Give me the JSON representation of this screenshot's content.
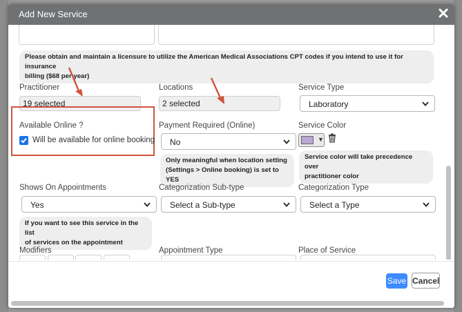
{
  "dialog": {
    "title": "Add New Service"
  },
  "cpt_note": {
    "line1": "Please obtain and maintain a licensure to utilize the American Medical Associations CPT codes if you intend to use it for insurance",
    "line2": "billing ($68 per year)"
  },
  "practitioner": {
    "label": "Practitioner",
    "value": "19 selected"
  },
  "locations": {
    "label": "Locations",
    "value": "2 selected"
  },
  "service_type": {
    "label": "Service Type",
    "value": "Laboratory"
  },
  "available_online": {
    "label": "Available Online ?",
    "checkbox_label": "Will be available for online booking",
    "checked": true
  },
  "payment_required": {
    "label": "Payment Required (Online)",
    "value": "No",
    "note_line1": "Only meaningful when location setting",
    "note_line2": "(Settings > Online booking) is set to YES"
  },
  "service_color": {
    "label": "Service Color",
    "color": "#b9a7d6",
    "note_line1": "Service color will take precedence over",
    "note_line2": "practitioner color"
  },
  "shows_on_appointments": {
    "label": "Shows On Appointments",
    "value": "Yes",
    "note_line1": "If you want to see this service in the list",
    "note_line2": "of services on the appointment"
  },
  "categorization_subtype": {
    "label": "Categorization Sub-type",
    "value": "Select a Sub-type"
  },
  "categorization_type": {
    "label": "Categorization Type",
    "value": "Select a Type"
  },
  "modifiers": {
    "label": "Modifiers"
  },
  "appointment_type": {
    "label": "Appointment Type"
  },
  "place_of_service": {
    "label": "Place of Service"
  },
  "footer": {
    "save_label": "Save",
    "cancel_label": "Cancel"
  },
  "colors": {
    "titlebar": "#6f7173",
    "highlight": "#d0533c",
    "primary": "#3d8bfd"
  },
  "icons": [
    "close-icon",
    "chevron-down-icon",
    "trash-icon",
    "checkbox-checked-icon"
  ]
}
